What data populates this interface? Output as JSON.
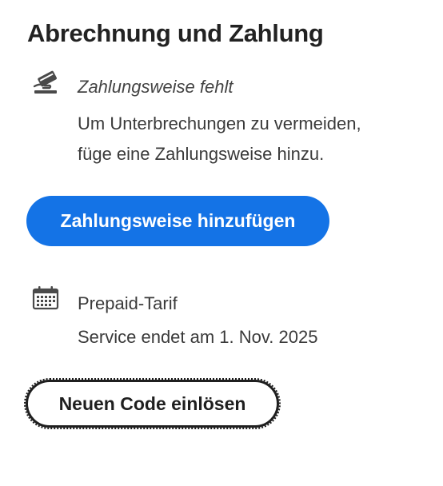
{
  "section": {
    "title": "Abrechnung und Zahlung"
  },
  "payment": {
    "icon": "card-hand-icon",
    "status": "Zahlungsweise fehlt",
    "message_line1": "Um Unterbrechungen zu vermeiden,",
    "message_line2": "füge eine Zahlungsweise hinzu.",
    "add_button_label": "Zahlungsweise hinzufügen"
  },
  "plan": {
    "icon": "calendar-icon",
    "name": "Prepaid-Tarif",
    "service_end": "Service endet am 1. Nov. 2025",
    "redeem_button_label": "Neuen Code einlösen"
  },
  "colors": {
    "accent": "#1473e6",
    "text": "#2c2c2c",
    "icon": "#4a4a4a"
  }
}
